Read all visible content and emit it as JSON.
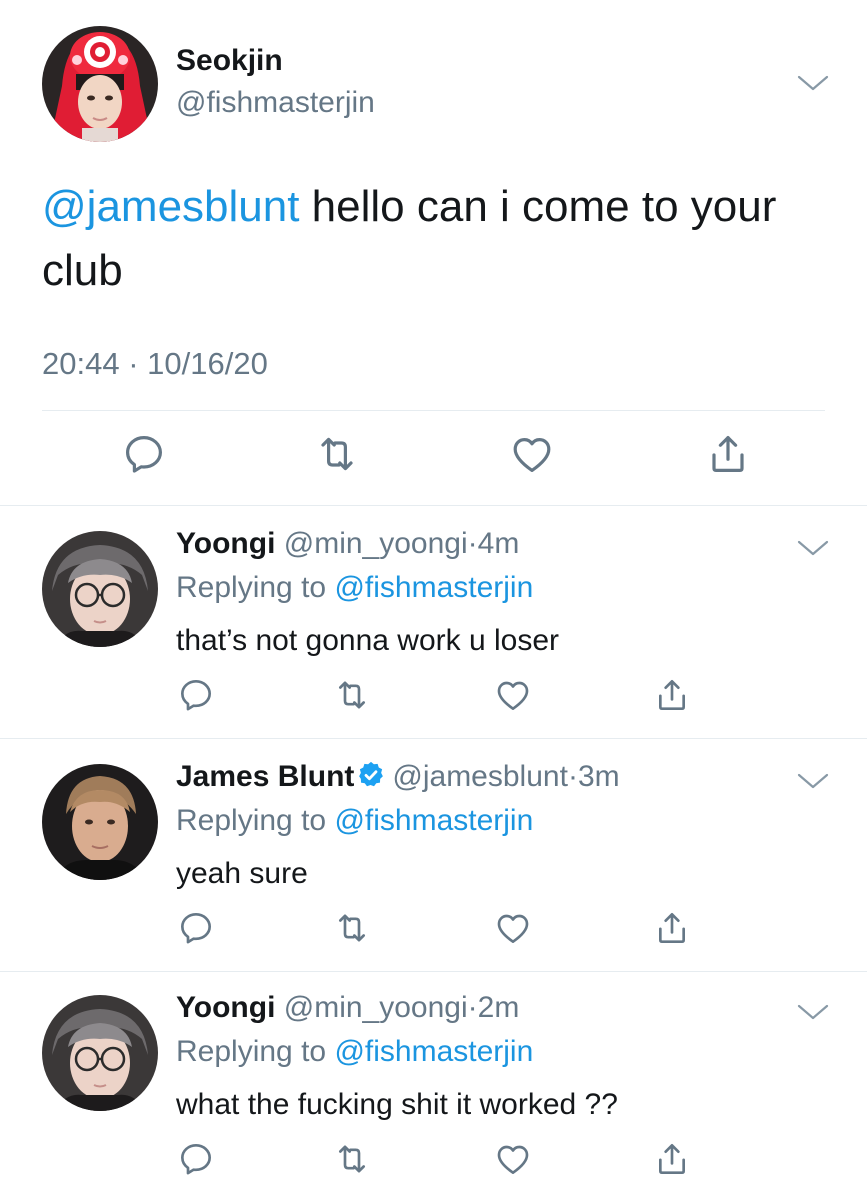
{
  "main_tweet": {
    "display_name": "Seokjin",
    "handle": "@fishmasterjin",
    "mention": "@jamesblunt",
    "text": " hello can i come to your club",
    "time": "20:44",
    "separator": "·",
    "date": "10/16/20",
    "actions": [
      "reply-icon",
      "retweet-icon",
      "like-icon",
      "share-icon"
    ]
  },
  "replies": [
    {
      "display_name": "Yoongi",
      "handle": "@min_yoongi",
      "dot": "·",
      "time": "4m",
      "verified": false,
      "replying_prefix": "Replying to ",
      "replying_to": "@fishmasterjin",
      "text": "that’s not gonna work u loser"
    },
    {
      "display_name": "James Blunt",
      "handle": "@jamesblunt",
      "dot": "·",
      "time": "3m",
      "verified": true,
      "replying_prefix": "Replying to ",
      "replying_to": "@fishmasterjin",
      "text": "yeah sure"
    },
    {
      "display_name": "Yoongi",
      "handle": "@min_yoongi",
      "dot": "·",
      "time": "2m",
      "verified": false,
      "replying_prefix": "Replying to ",
      "replying_to": "@fishmasterjin",
      "text": "what the fucking shit it worked ??"
    }
  ],
  "colors": {
    "link": "#1b95e0",
    "secondary_text": "#657786",
    "icon": "#657786",
    "divider": "#e6ecf0"
  }
}
